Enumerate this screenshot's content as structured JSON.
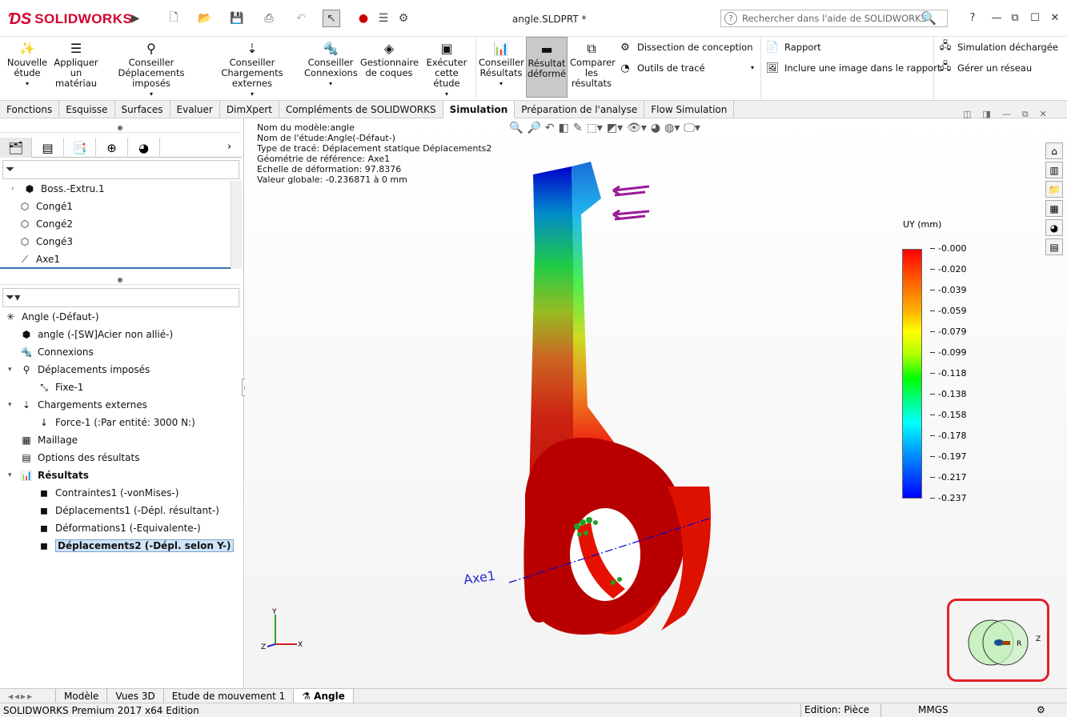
{
  "app": {
    "logo": "SOLIDWORKS",
    "doc_title": "angle.SLDPRT *",
    "search_placeholder": "Rechercher dans l'aide de SOLIDWORKS"
  },
  "ribbon": {
    "nouvelle_etude": "Nouvelle étude",
    "appliquer": "Appliquer un matériau",
    "conseiller_deplacements": "Conseiller Déplacements imposés",
    "conseiller_chargements": "Conseiller Chargements externes",
    "conseiller_connexions": "Conseiller Connexions",
    "gestionnaire_coques": "Gestionnaire de coques",
    "executer": "Exécuter cette étude",
    "conseiller_resultats": "Conseiller Résultats",
    "resultat_deforme": "Résultat déformé",
    "comparer": "Comparer les résultats",
    "dissection": "Dissection de conception",
    "outils_trace": "Outils de tracé",
    "rapport": "Rapport",
    "inclure_image": "Inclure une image dans le rapport",
    "simulation_dechargee": "Simulation déchargée",
    "gerer_reseau": "Gérer un réseau"
  },
  "tabs": [
    "Fonctions",
    "Esquisse",
    "Surfaces",
    "Evaluer",
    "DimXpert",
    "Compléments de SOLIDWORKS",
    "Simulation",
    "Préparation de l'analyse",
    "Flow Simulation"
  ],
  "feature_tree": [
    {
      "label": "Boss.-Extru.1"
    },
    {
      "label": "Congé1"
    },
    {
      "label": "Congé2"
    },
    {
      "label": "Congé3"
    },
    {
      "label": "Axe1"
    }
  ],
  "study_tree": {
    "root": "Angle (-Défaut-)",
    "part": "angle (-[SW]Acier non allié-)",
    "connexions": "Connexions",
    "deplacements": "Déplacements imposés",
    "fixe": "Fixe-1",
    "chargements": "Chargements externes",
    "force": "Force-1 (:Par entité: 3000 N:)",
    "maillage": "Maillage",
    "options": "Options des résultats",
    "resultats": "Résultats",
    "r1": "Contraintes1 (-vonMises-)",
    "r2": "Déplacements1 (-Dépl. résultant-)",
    "r3": "Déformations1 (-Equivalente-)",
    "r4": "Déplacements2 (-Dépl. selon Y-)"
  },
  "viewport_info": [
    "Nom du modèle:angle",
    "Nom de l'étude:Angle(-Défaut-)",
    "Type de tracé: Déplacement statique Déplacements2",
    "Géométrie de référence: Axe1",
    "Echelle de déformation: 97.8376",
    "Valeur globale: -0.236871 à 0 mm"
  ],
  "legend": {
    "title": "UY (mm)",
    "ticks": [
      "-0.000",
      "-0.020",
      "-0.039",
      "-0.059",
      "-0.079",
      "-0.099",
      "-0.118",
      "-0.138",
      "-0.158",
      "-0.178",
      "-0.197",
      "-0.217",
      "-0.237"
    ]
  },
  "axis_label": "Axe1",
  "bottom_tabs": [
    "Modèle",
    "Vues 3D",
    "Etude de mouvement 1",
    "Angle"
  ],
  "status": {
    "edition": "SOLIDWORKS Premium 2017 x64 Edition",
    "mode": "Edition: Pièce",
    "units": "MMGS"
  },
  "colors": {
    "brand_red": "#d3002d",
    "selection": "#cfe4f8",
    "triad_highlight": "#e0202a"
  }
}
